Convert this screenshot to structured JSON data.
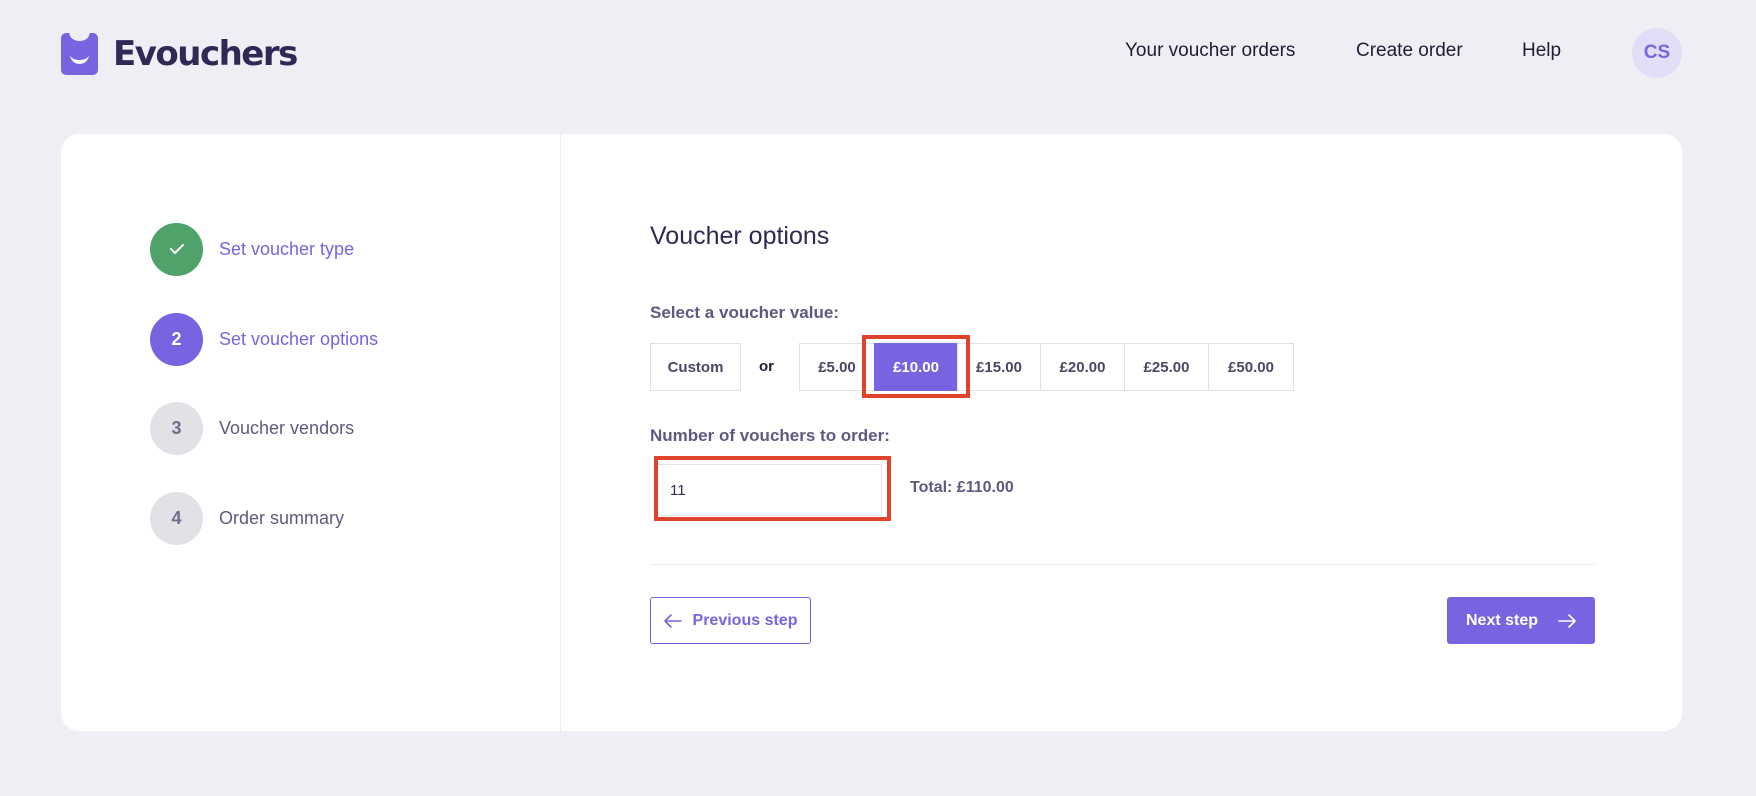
{
  "header": {
    "brand": "Evouchers",
    "nav": [
      "Your voucher orders",
      "Create order",
      "Help"
    ],
    "avatar_initials": "CS"
  },
  "steps": [
    {
      "number": "",
      "label": "Set voucher type",
      "state": "done",
      "icon": "check-icon"
    },
    {
      "number": "2",
      "label": "Set voucher options",
      "state": "active"
    },
    {
      "number": "3",
      "label": "Voucher vendors",
      "state": "todo"
    },
    {
      "number": "4",
      "label": "Order summary",
      "state": "todo"
    }
  ],
  "main": {
    "title": "Voucher options",
    "value_label": "Select a voucher value:",
    "custom_label": "Custom",
    "or_label": "or",
    "values": [
      "£5.00",
      "£10.00",
      "£15.00",
      "£20.00",
      "£25.00",
      "£50.00"
    ],
    "selected_value": "£10.00",
    "quantity_label": "Number of vouchers to order:",
    "quantity_value": "11",
    "total": "Total: £110.00",
    "prev_label": "Previous step",
    "next_label": "Next step"
  },
  "colors": {
    "accent": "#7a63e0",
    "success": "#4fa36a",
    "highlight": "#e0432b",
    "background": "#efeef4"
  }
}
